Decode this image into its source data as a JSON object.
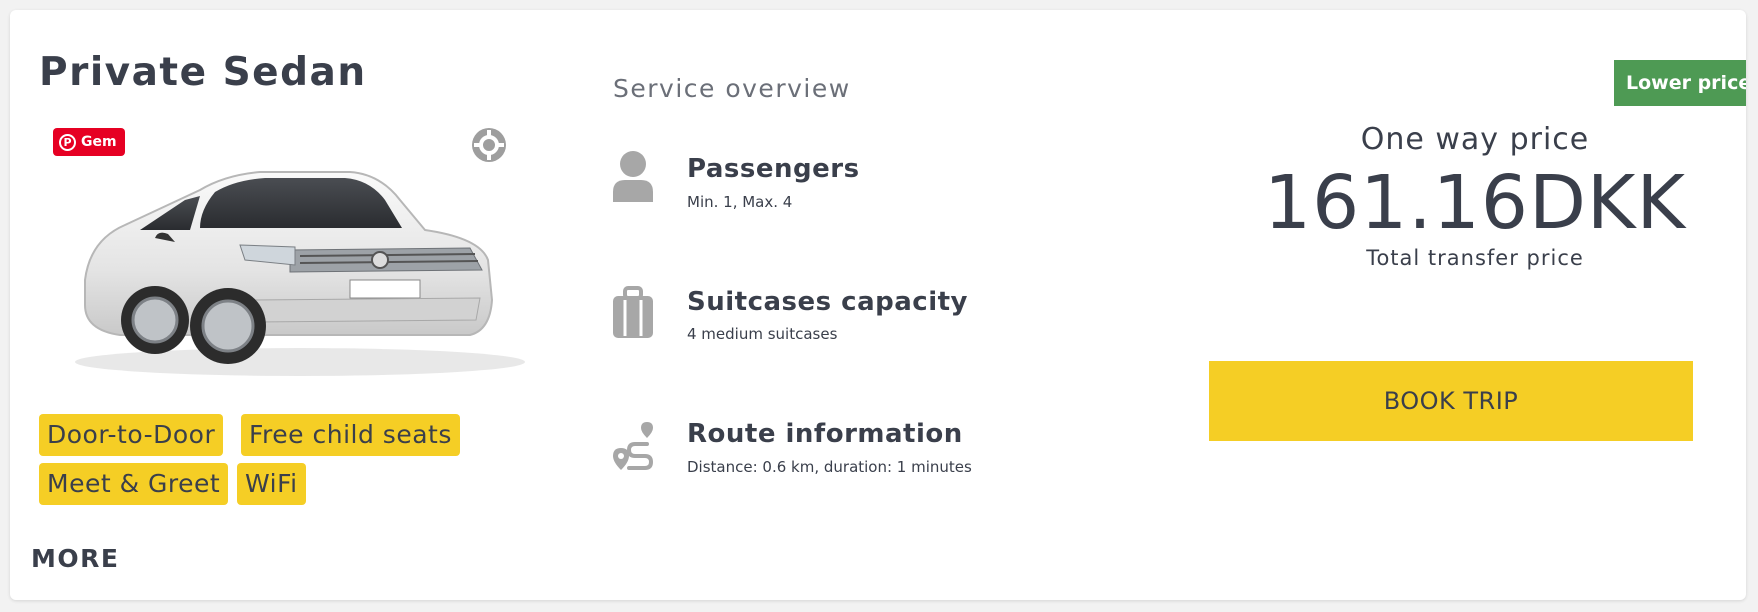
{
  "vehicle": {
    "title": "Private Sedan",
    "image_icon": "sedan-car-image",
    "pinterest_badge": {
      "letter": "P",
      "label": "Gem",
      "color": "#e60023"
    },
    "zoom_icon": "zoom-crosshair-icon",
    "features": [
      "Door-to-Door",
      "Free child seats",
      "Meet & Greet",
      "WiFi"
    ],
    "more_label": "MORE"
  },
  "service": {
    "heading": "Service overview",
    "items": [
      {
        "icon": "person-icon",
        "title": "Passengers",
        "detail": "Min. 1, Max. 4"
      },
      {
        "icon": "suitcase-icon",
        "title": "Suitcases capacity",
        "detail": "4 medium suitcases"
      },
      {
        "icon": "route-icon",
        "title": "Route information",
        "detail": "Distance: 0.6 km, duration: 1 minutes"
      }
    ]
  },
  "pricing": {
    "badge": "Lower price",
    "label": "One way price",
    "amount": "161.16DKK",
    "sublabel": "Total transfer price",
    "cta": "BOOK TRIP"
  },
  "colors": {
    "accent_yellow": "#f5ce25",
    "badge_green": "#4e9a54",
    "text_dark": "#3a3f4b",
    "icon_grey": "#a7a7a7"
  }
}
